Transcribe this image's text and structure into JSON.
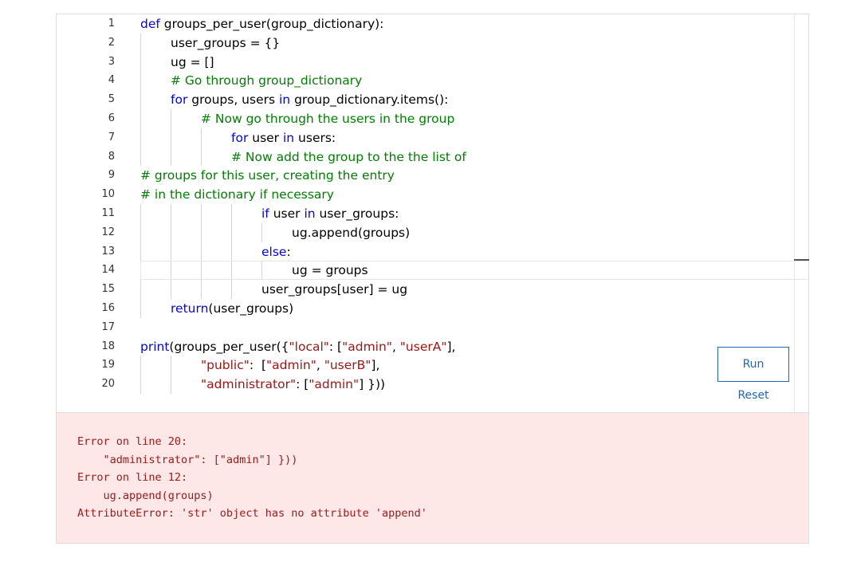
{
  "editor": {
    "line_numbers": [
      "1",
      "2",
      "3",
      "4",
      "5",
      "6",
      "7",
      "8",
      "9",
      "10",
      "11",
      "12",
      "13",
      "14",
      "15",
      "16",
      "17",
      "18",
      "19",
      "20"
    ],
    "lines": [
      {
        "indent": 0,
        "tokens": [
          {
            "t": "def",
            "c": "kw"
          },
          {
            "t": " groups_per_user(group_dictionary):"
          }
        ]
      },
      {
        "indent": 1,
        "tokens": [
          {
            "t": "user_groups = {}"
          }
        ]
      },
      {
        "indent": 1,
        "tokens": [
          {
            "t": "ug = []"
          }
        ]
      },
      {
        "indent": 1,
        "tokens": [
          {
            "t": "# Go through group_dictionary",
            "c": "cm"
          }
        ]
      },
      {
        "indent": 1,
        "tokens": [
          {
            "t": "for",
            "c": "kw"
          },
          {
            "t": " groups, users "
          },
          {
            "t": "in",
            "c": "kw"
          },
          {
            "t": " group_dictionary.items():"
          }
        ]
      },
      {
        "indent": 2,
        "tokens": [
          {
            "t": "# Now go through the users in the group",
            "c": "cm"
          }
        ]
      },
      {
        "indent": 3,
        "tokens": [
          {
            "t": "for",
            "c": "kw"
          },
          {
            "t": " user "
          },
          {
            "t": "in",
            "c": "kw"
          },
          {
            "t": " users:"
          }
        ]
      },
      {
        "indent": 3,
        "tokens": [
          {
            "t": "# Now add the group to the the list of",
            "c": "cm"
          }
        ]
      },
      {
        "indent": 0,
        "tokens": [
          {
            "t": "# groups for this user, creating the entry",
            "c": "cm"
          }
        ]
      },
      {
        "indent": 0,
        "tokens": [
          {
            "t": "# in the dictionary if necessary",
            "c": "cm"
          }
        ]
      },
      {
        "indent": 4,
        "tokens": [
          {
            "t": "if",
            "c": "kw"
          },
          {
            "t": " user "
          },
          {
            "t": "in",
            "c": "kw"
          },
          {
            "t": " user_groups:"
          }
        ]
      },
      {
        "indent": 5,
        "tokens": [
          {
            "t": "ug.append(groups)"
          }
        ]
      },
      {
        "indent": 4,
        "tokens": [
          {
            "t": "else",
            "c": "kw"
          },
          {
            "t": ":"
          }
        ]
      },
      {
        "indent": 5,
        "tokens": [
          {
            "t": "ug = groups"
          }
        ]
      },
      {
        "indent": 4,
        "tokens": [
          {
            "t": "user_groups[user] = ug"
          }
        ]
      },
      {
        "indent": 1,
        "tokens": [
          {
            "t": "return",
            "c": "kw"
          },
          {
            "t": "(user_groups)"
          }
        ]
      },
      {
        "indent": 0,
        "tokens": []
      },
      {
        "indent": 0,
        "tokens": [
          {
            "t": "print",
            "c": "kw"
          },
          {
            "t": "(groups_per_user({"
          },
          {
            "t": "\"local\"",
            "c": "st"
          },
          {
            "t": ": ["
          },
          {
            "t": "\"admin\"",
            "c": "st"
          },
          {
            "t": ", "
          },
          {
            "t": "\"userA\"",
            "c": "st"
          },
          {
            "t": "],"
          }
        ]
      },
      {
        "indent": 2,
        "tokens": [
          {
            "t": "\"public\"",
            "c": "st"
          },
          {
            "t": ":  ["
          },
          {
            "t": "\"admin\"",
            "c": "st"
          },
          {
            "t": ", "
          },
          {
            "t": "\"userB\"",
            "c": "st"
          },
          {
            "t": "],"
          }
        ]
      },
      {
        "indent": 2,
        "tokens": [
          {
            "t": "\"administrator\"",
            "c": "st"
          },
          {
            "t": ": ["
          },
          {
            "t": "\"admin\"",
            "c": "st"
          },
          {
            "t": "] }))"
          }
        ]
      }
    ]
  },
  "controls": {
    "run_label": "Run",
    "reset_label": "Reset"
  },
  "output": {
    "lines": [
      "Error on line 20:",
      "    \"administrator\": [\"admin\"] }))",
      "Error on line 12:",
      "    ug.append(groups)",
      "AttributeError: 'str' object has no attribute 'append'"
    ]
  },
  "colors": {
    "keyword": "#0000ff",
    "comment": "#008000",
    "string": "#a31515",
    "accent": "#2266bb",
    "error_text": "#a11b1b",
    "error_background": "#fde7e7"
  }
}
